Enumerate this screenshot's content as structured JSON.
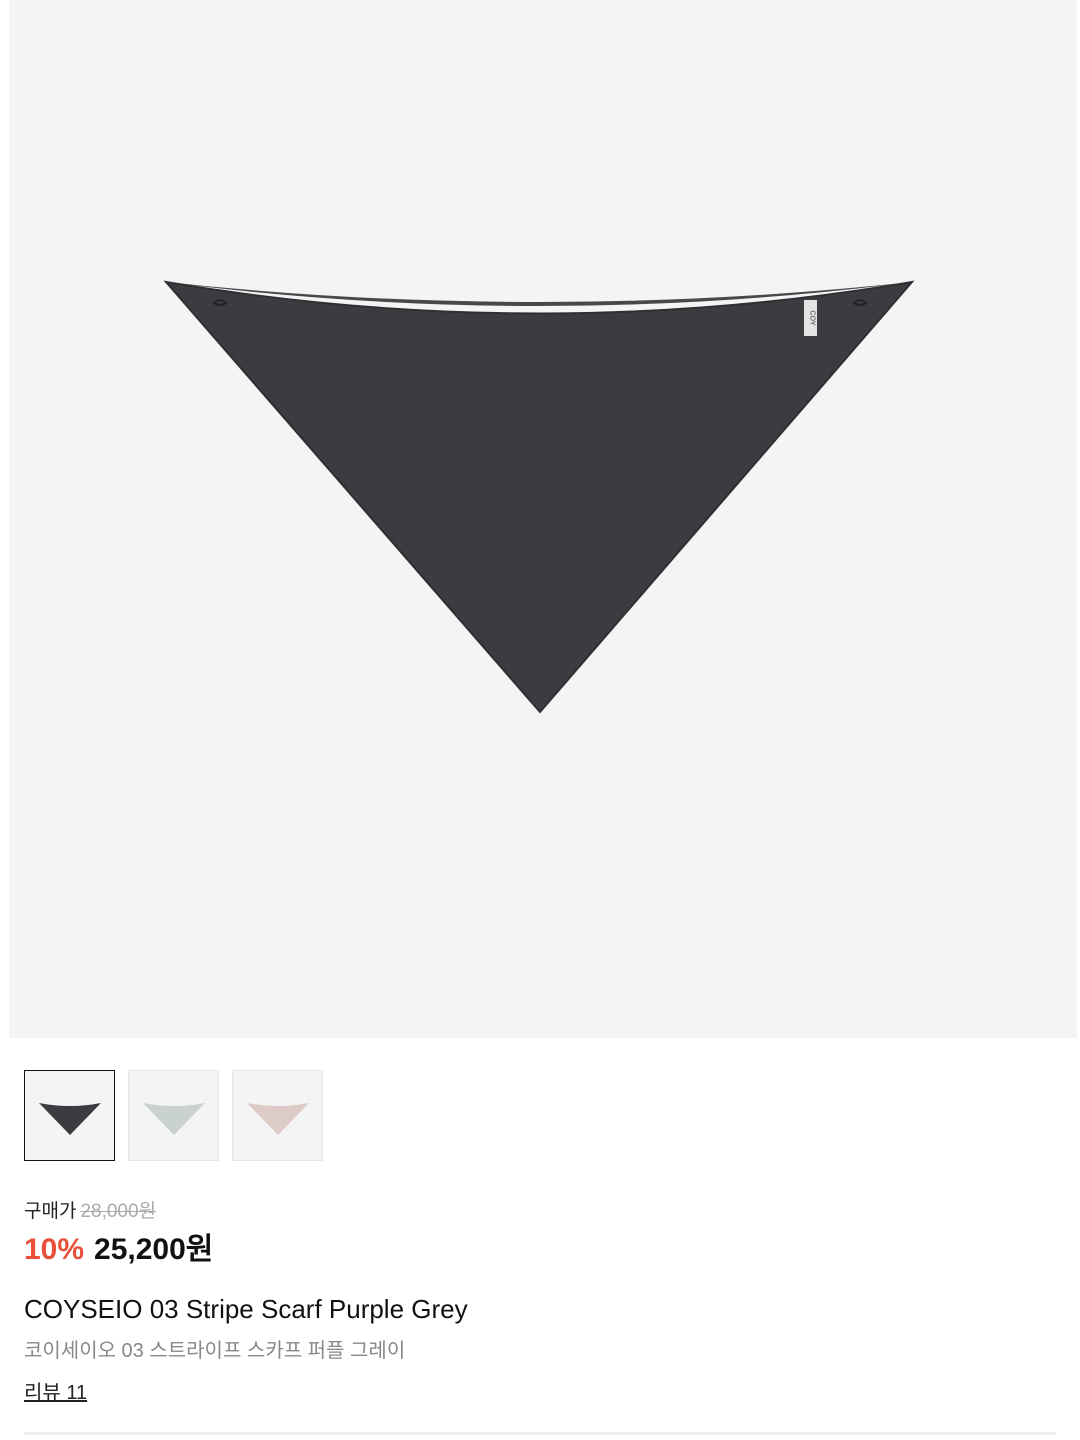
{
  "product": {
    "main_image_alt": "scarf-image",
    "thumbnails": [
      {
        "name": "purple-grey",
        "color": "#3b3c40"
      },
      {
        "name": "mint",
        "color": "#c9d2cf"
      },
      {
        "name": "pink",
        "color": "#dccbc6"
      }
    ],
    "selected_thumbnail": 0,
    "price": {
      "label": "구매가",
      "original": "28,000원",
      "discount": "10%",
      "final": "25,200원"
    },
    "title_en": "COYSEIO 03 Stripe Scarf Purple Grey",
    "title_ko": "코이세이오 03 스트라이프 스카프 퍼플 그레이",
    "review_link": "리뷰 11",
    "tag_text": "COY"
  },
  "colors": {
    "discount": "#e8503a",
    "image_bg": "#f4f4f4",
    "scarf_main": "#3b3c40"
  }
}
